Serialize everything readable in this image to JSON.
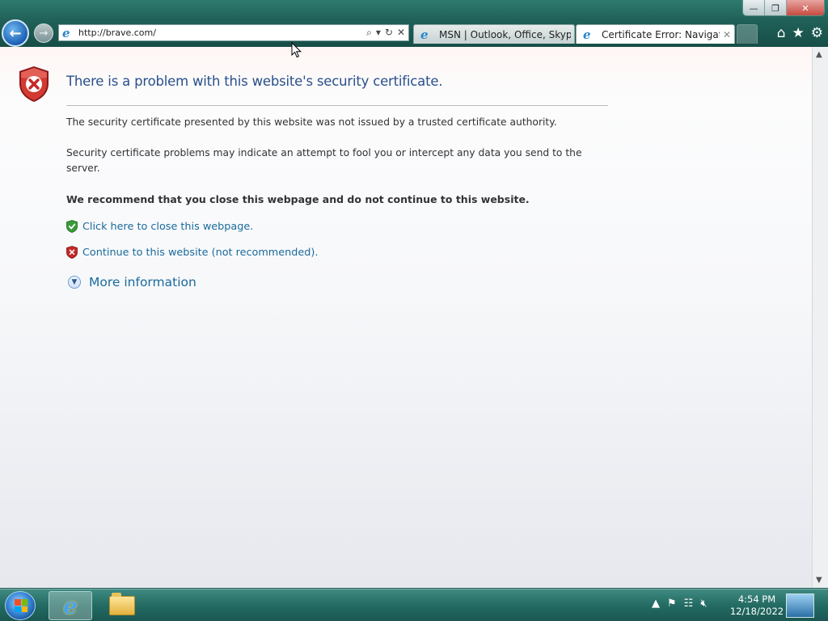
{
  "browser": {
    "address_url": "http://brave.com/",
    "tabs": [
      {
        "label": "MSN | Outlook, Office, Skype, ...",
        "active": false
      },
      {
        "label": "Certificate Error: Navigation...",
        "active": true
      }
    ],
    "window_controls": {
      "minimize": "—",
      "restore": "❐",
      "close": "✕"
    }
  },
  "page": {
    "heading": "There is a problem with this website's security certificate.",
    "paragraph1": "The security certificate presented by this website was not issued by a trusted certificate authority.",
    "paragraph2": "Security certificate problems may indicate an attempt to fool you or intercept any data you send to the server.",
    "recommendation": "We recommend that you close this webpage and do not continue to this website.",
    "close_link": "Click here to close this webpage.",
    "continue_link": "Continue to this website (not recommended).",
    "more_info": "More information"
  },
  "taskbar": {
    "time": "4:54 PM",
    "date": "12/18/2022"
  },
  "colors": {
    "heading": "#28508c",
    "link": "#1a6a9c",
    "error_shield": "#c62828",
    "safe_shield": "#3a9a3a"
  }
}
